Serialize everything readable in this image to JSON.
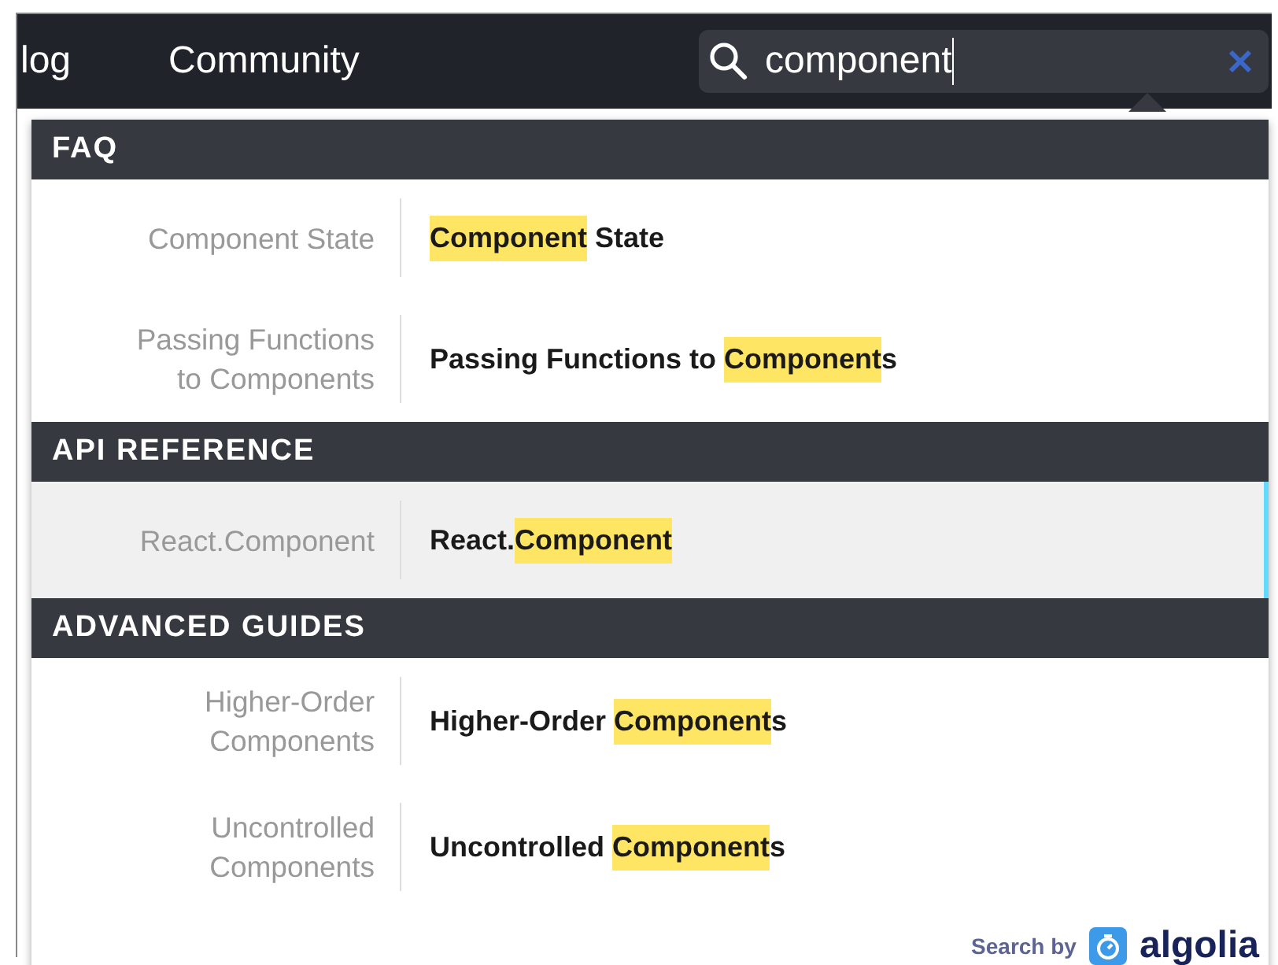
{
  "nav": {
    "links": [
      "log",
      "Community"
    ]
  },
  "search": {
    "value": "component"
  },
  "sections": [
    {
      "title": "FAQ",
      "results": [
        {
          "category": [
            "Component State"
          ],
          "title": [
            {
              "text": "Component",
              "highlight": true
            },
            {
              "text": " State",
              "highlight": false
            }
          ],
          "selected": false
        },
        {
          "category": [
            "Passing Functions",
            "to Components"
          ],
          "title": [
            {
              "text": "Passing Functions to ",
              "highlight": false
            },
            {
              "text": "Component",
              "highlight": true
            },
            {
              "text": "s",
              "highlight": false
            }
          ],
          "selected": false
        }
      ]
    },
    {
      "title": "API REFERENCE",
      "results": [
        {
          "category": [
            "React.Component"
          ],
          "title": [
            {
              "text": "React.",
              "highlight": false
            },
            {
              "text": "Component",
              "highlight": true
            }
          ],
          "selected": true
        }
      ]
    },
    {
      "title": "ADVANCED GUIDES",
      "results": [
        {
          "category": [
            "Higher-Order",
            "Components"
          ],
          "title": [
            {
              "text": "Higher-Order ",
              "highlight": false
            },
            {
              "text": "Component",
              "highlight": true
            },
            {
              "text": "s",
              "highlight": false
            }
          ],
          "selected": false
        },
        {
          "category": [
            "Uncontrolled",
            "Components"
          ],
          "title": [
            {
              "text": "Uncontrolled ",
              "highlight": false
            },
            {
              "text": "Component",
              "highlight": true
            },
            {
              "text": "s",
              "highlight": false
            }
          ],
          "selected": false
        }
      ]
    }
  ],
  "footer": {
    "label": "Search by",
    "brand": "algolia"
  }
}
